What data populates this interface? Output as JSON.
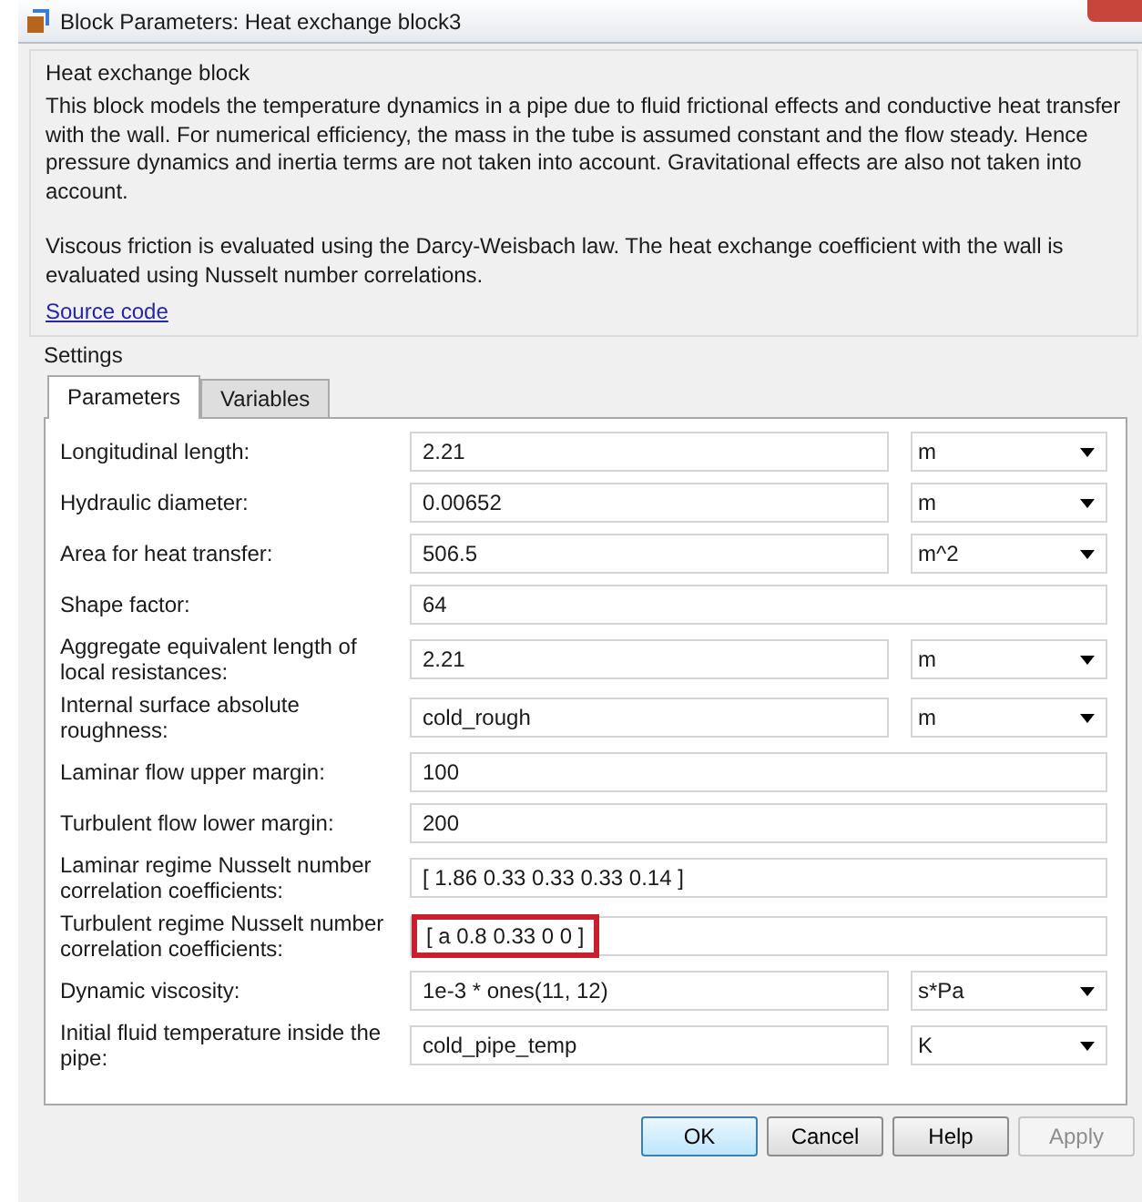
{
  "window": {
    "title": "Block Parameters: Heat exchange block3"
  },
  "description": {
    "heading": "Heat exchange block",
    "paragraphs": [
      "This block models the temperature dynamics in a pipe due to fluid frictional effects and conductive heat transfer with the wall. For numerical efficiency, the mass in the tube is assumed constant and the flow steady. Hence pressure dynamics and inertia terms are not taken into account. Gravitational effects are also not taken into account.",
      "Viscous friction is evaluated using the Darcy-Weisbach law. The heat exchange coefficient with the wall is evaluated using Nusselt number correlations."
    ],
    "link": "Source code"
  },
  "settings": {
    "heading": "Settings",
    "tabs": [
      {
        "label": "Parameters",
        "selected": true
      },
      {
        "label": "Variables",
        "selected": false
      }
    ],
    "parameters": [
      {
        "label": "Longitudinal length:",
        "value": "2.21",
        "unit": "m",
        "highlighted": false
      },
      {
        "label": "Hydraulic diameter:",
        "value": "0.00652",
        "unit": "m",
        "highlighted": false
      },
      {
        "label": "Area for heat transfer:",
        "value": "506.5",
        "unit": "m^2",
        "highlighted": false
      },
      {
        "label": "Shape factor:",
        "value": "64",
        "highlighted": false
      },
      {
        "label": "Aggregate equivalent length of local resistances:",
        "value": "2.21",
        "unit": "m",
        "highlighted": false
      },
      {
        "label": "Internal surface absolute roughness:",
        "value": "cold_rough",
        "unit": "m",
        "highlighted": false
      },
      {
        "label": "Laminar flow upper margin:",
        "value": "100",
        "highlighted": false
      },
      {
        "label": "Turbulent flow lower margin:",
        "value": "200",
        "highlighted": false
      },
      {
        "label": "Laminar regime Nusselt number correlation coefficients:",
        "value": "[ 1.86 0.33 0.33 0.33 0.14 ]",
        "highlighted": false
      },
      {
        "label": "Turbulent regime Nusselt number correlation coefficients:",
        "value": "[ a 0.8 0.33 0 0 ]",
        "highlighted": true
      },
      {
        "label": "Dynamic viscosity:",
        "value": "1e-3 * ones(11, 12)",
        "unit": "s*Pa",
        "highlighted": false
      },
      {
        "label": "Initial fluid temperature inside the pipe:",
        "value": "cold_pipe_temp",
        "unit": "K",
        "highlighted": false
      }
    ]
  },
  "buttons": [
    {
      "label": "OK",
      "kind": "default",
      "disabled": false
    },
    {
      "label": "Cancel",
      "kind": "normal",
      "disabled": false
    },
    {
      "label": "Help",
      "kind": "normal",
      "disabled": false
    },
    {
      "label": "Apply",
      "kind": "normal",
      "disabled": true
    }
  ]
}
